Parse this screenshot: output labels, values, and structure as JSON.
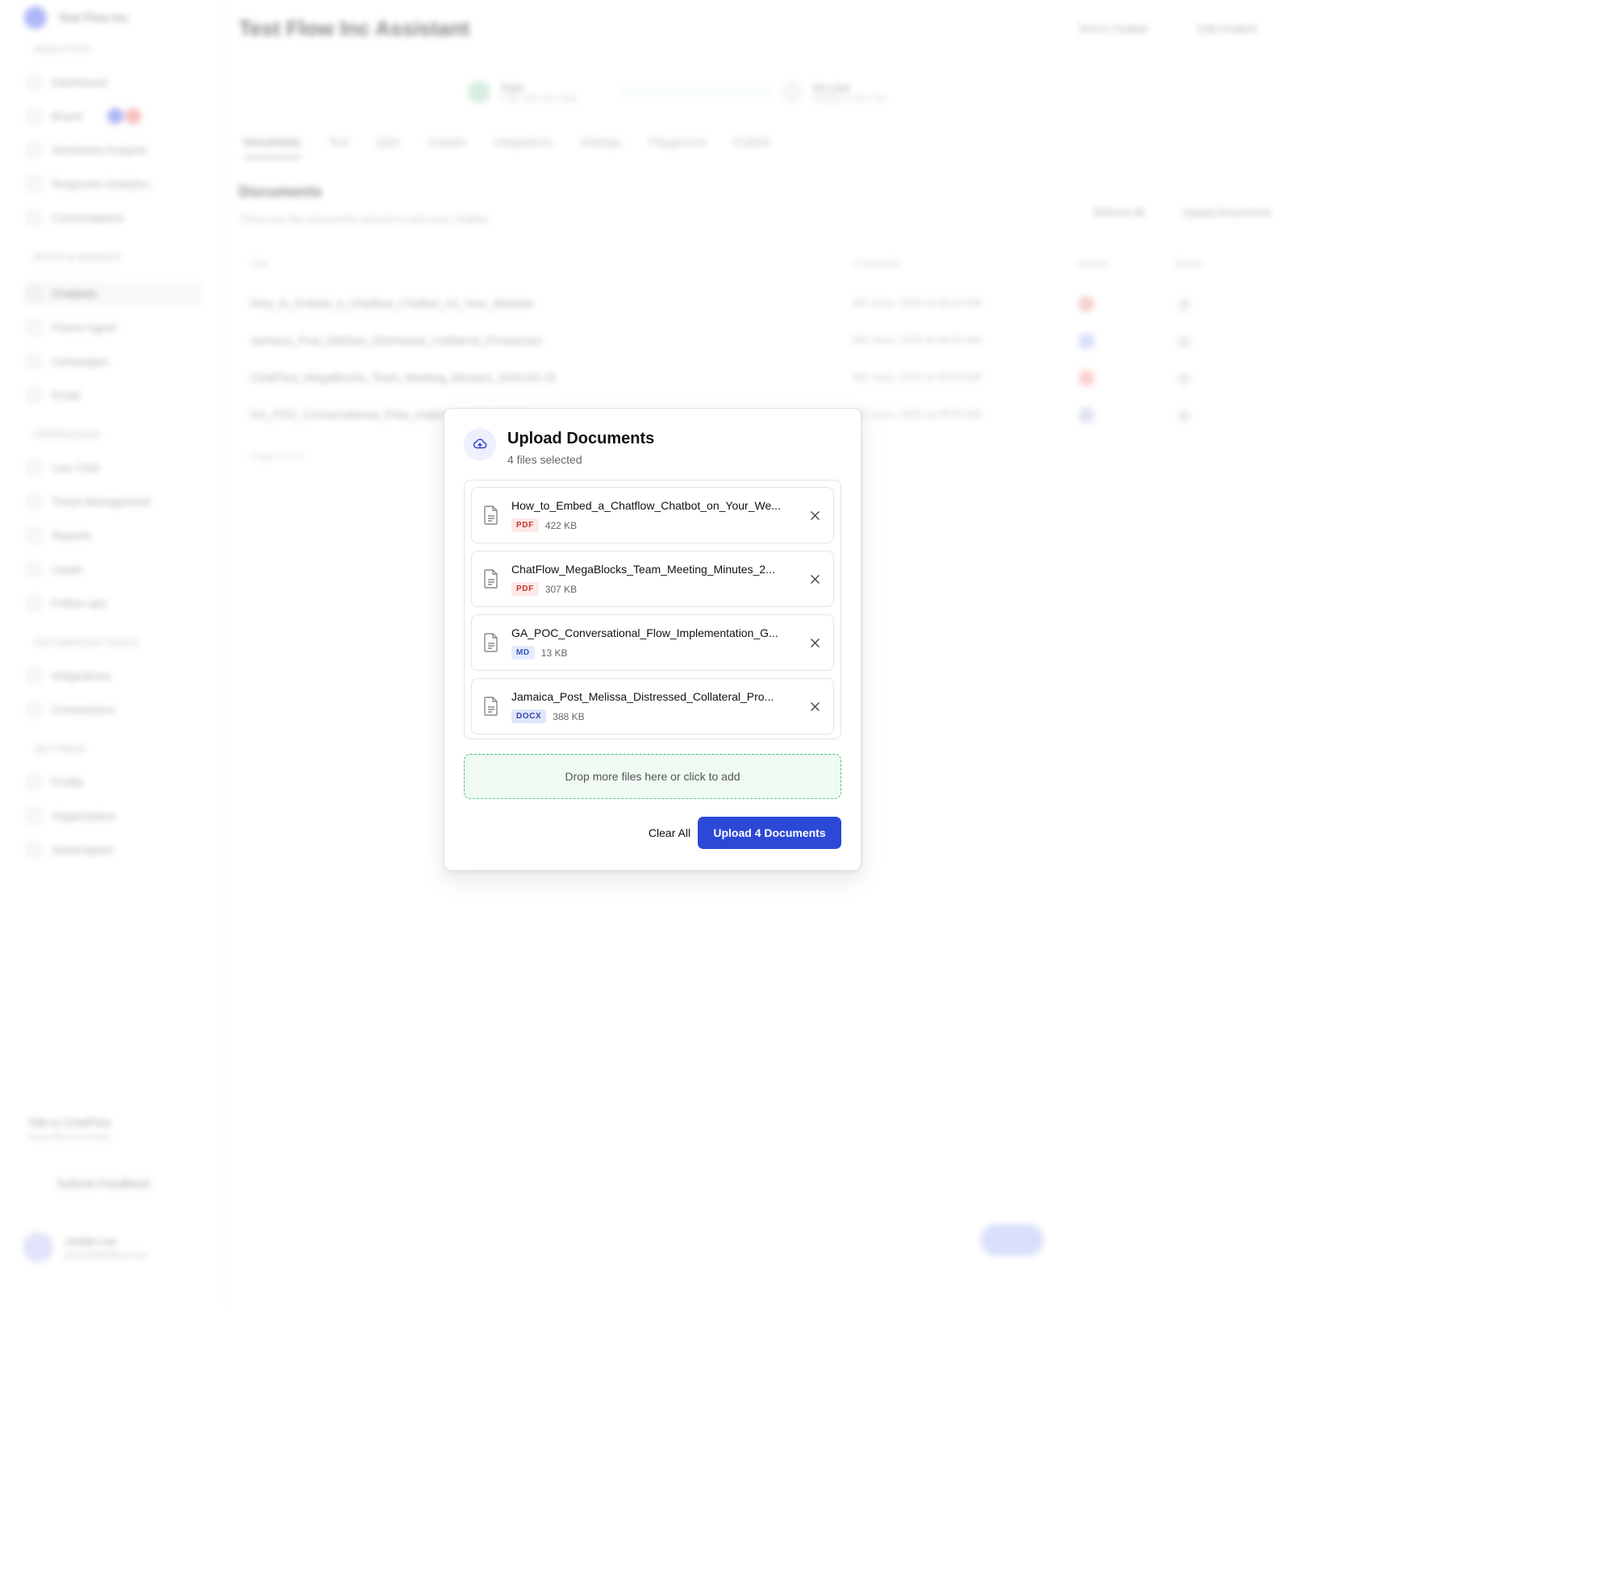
{
  "background": {
    "sidebar": {
      "brand": "Test Flow Inc",
      "sections": [
        "ANALYTICS",
        "BUILD & MANAGE",
        "OPERATIONS",
        "AUTOMATION TOOLS",
        "SETTINGS"
      ],
      "items": [
        "Dashboard",
        "Brand",
        "Sentiment Analysis",
        "Response Analytics",
        "Conversations",
        "Chatbots",
        "Phone Agent",
        "Campaigns",
        "Email",
        "Live Chat",
        "Ticket Management",
        "Reports",
        "Leads",
        "Follow-ups",
        "Integrations",
        "Connections",
        "Profile",
        "Organization",
        "Subscription"
      ],
      "talk": "Talk to ChatFlow",
      "talk_sub": "Press ⌘K for AI help",
      "feedback": "Submit Feedback",
      "user_name": "Jordan Lee",
      "user_email": "jordan@testflow.com"
    },
    "main": {
      "title": "Test Flow Inc Assistant",
      "header_buttons": [
        "Test in Chatbot",
        "Edit Chatbot"
      ],
      "steps": [
        {
          "label": "Train",
          "sub": "Train with your data"
        },
        {
          "label": "Go Live",
          "sub": "Deploy to your site"
        }
      ],
      "tabs": [
        "Documents",
        "Text",
        "Q&A",
        "Crawler",
        "Integrations",
        "Settings",
        "Playground",
        "Publish"
      ],
      "section_title": "Documents",
      "section_sub": "These are the documents trained to train your chatbot",
      "section_buttons": [
        "Refresh All",
        "Upload Documents"
      ],
      "columns": [
        "Title",
        "Created At",
        "Source",
        "Status"
      ],
      "rows": [
        {
          "title": "How_to_Embed_a_Chatflow_Chatbot_on_Your_Website",
          "date": "8th June, 2025 at 09:55 AM"
        },
        {
          "title": "Jamaica_Post_Melissa_Distressed_Collateral_Prospectus",
          "date": "8th June, 2025 at 09:55 AM"
        },
        {
          "title": "ChatFlow_MegaBlocks_Team_Meeting_Minutes_2025-05-15",
          "date": "8th June, 2025 at 09:55 AM"
        },
        {
          "title": "GA_POC_Conversational_Flow_Implementation_Guide",
          "date": "8th June, 2025 at 09:55 AM"
        }
      ],
      "page_label": "Page 1 of 1"
    }
  },
  "modal": {
    "title": "Upload Documents",
    "subtitle": "4 files selected",
    "icon": "cloud-upload-icon",
    "files": [
      {
        "name": "How_to_Embed_a_Chatflow_Chatbot_on_Your_We...",
        "type": "PDF",
        "size": "422 KB"
      },
      {
        "name": "ChatFlow_MegaBlocks_Team_Meeting_Minutes_2...",
        "type": "PDF",
        "size": "307 KB"
      },
      {
        "name": "GA_POC_Conversational_Flow_Implementation_G...",
        "type": "MD",
        "size": "13 KB"
      },
      {
        "name": "Jamaica_Post_Melissa_Distressed_Collateral_Pro...",
        "type": "DOCX",
        "size": "388 KB"
      }
    ],
    "dropzone_text": "Drop more files here or click to add",
    "clear_label": "Clear All",
    "upload_label": "Upload 4 Documents"
  },
  "colors": {
    "primary": "#2b48d6",
    "dropzone_border": "#4ac07b",
    "dropzone_bg": "#eefaf2",
    "pdf_badge": "#c0392b",
    "docx_badge": "#2f46b5"
  }
}
